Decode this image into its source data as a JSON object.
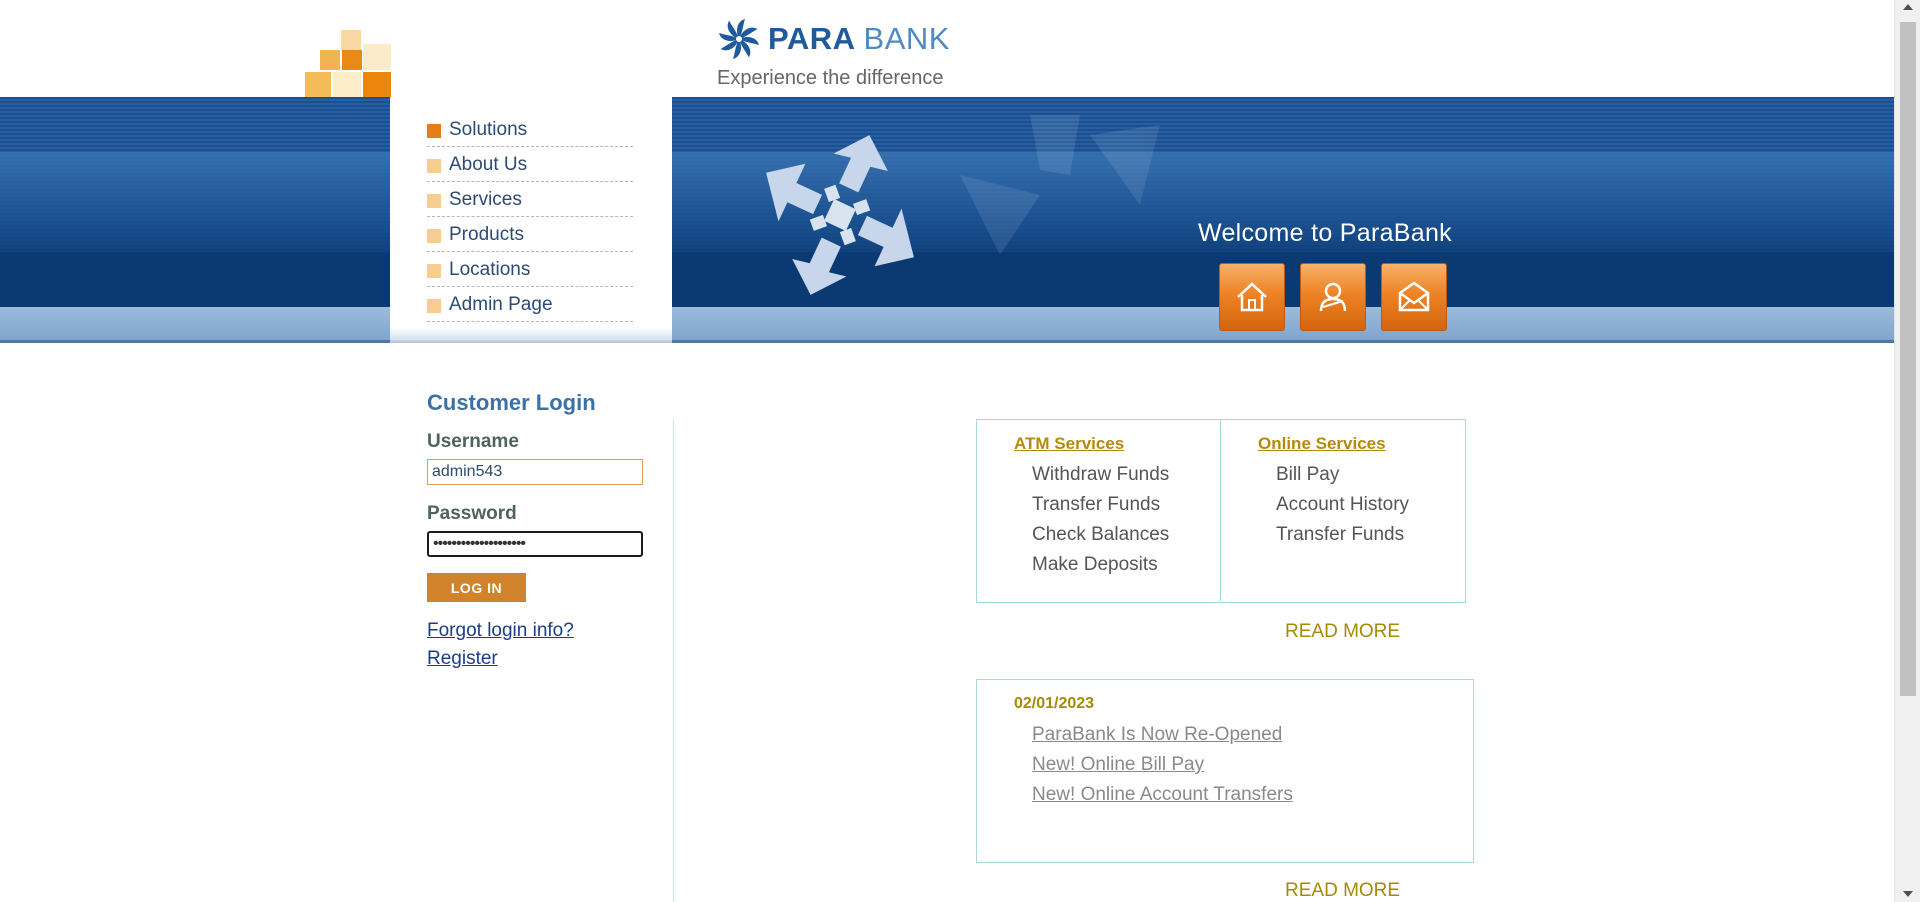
{
  "header": {
    "brand_bold": "PARA",
    "brand_light": "BANK",
    "tagline": "Experience the difference",
    "welcome": "Welcome to ParaBank"
  },
  "menu": {
    "items": [
      {
        "label": "Solutions"
      },
      {
        "label": "About Us"
      },
      {
        "label": "Services"
      },
      {
        "label": "Products"
      },
      {
        "label": "Locations"
      },
      {
        "label": "Admin Page"
      }
    ]
  },
  "header_buttons": [
    {
      "icon": "home-icon"
    },
    {
      "icon": "about-icon"
    },
    {
      "icon": "contact-icon"
    }
  ],
  "login": {
    "title": "Customer Login",
    "username_label": "Username",
    "username_value": "admin543",
    "password_label": "Password",
    "password_value": "••••••••••••••••••••",
    "button": "LOG IN",
    "forgot": "Forgot login info?",
    "register": "Register"
  },
  "services": {
    "atm_title": "ATM Services",
    "atm_items": [
      "Withdraw Funds",
      "Transfer Funds",
      "Check Balances",
      "Make Deposits"
    ],
    "online_title": "Online Services",
    "online_items": [
      "Bill Pay",
      "Account History",
      "Transfer Funds"
    ],
    "read_more": "READ MORE"
  },
  "news": {
    "date": "02/01/2023",
    "items": [
      "ParaBank Is Now Re-Opened",
      "New! Online Bill Pay",
      "New! Online Account Transfers"
    ],
    "read_more": "READ MORE"
  },
  "colors": {
    "brand_blue": "#1f5b9c",
    "accent_orange": "#e67e17",
    "link_gold": "#a48a05"
  }
}
